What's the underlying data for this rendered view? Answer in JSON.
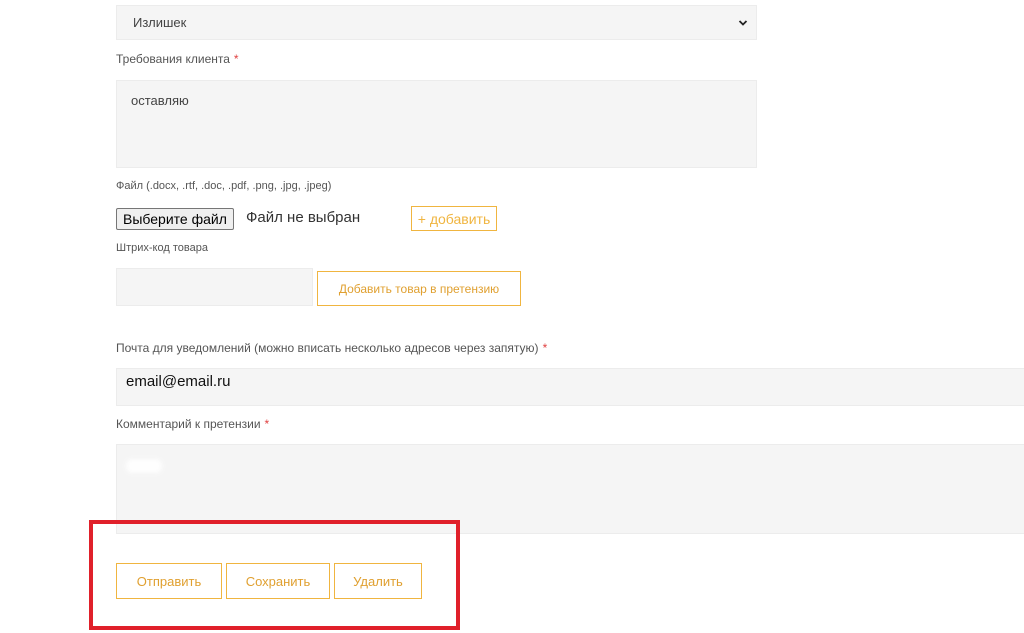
{
  "reason": {
    "value": "Излишек",
    "icon": "chevron-down-icon"
  },
  "client_requirements": {
    "label": "Требования клиента",
    "required_mark": "*",
    "value": "оставляю"
  },
  "file": {
    "label": "Файл (.docx, .rtf, .doc, .pdf, .png, .jpg, .jpeg)",
    "choose_label": "Выберите файл",
    "status": "Файл не выбран",
    "add_label": "+ добавить"
  },
  "barcode": {
    "label": "Штрих-код товара",
    "value": "",
    "add_label": "Добавить товар в претензию"
  },
  "email": {
    "label": "Почта для уведомлений (можно вписать несколько адресов через запятую)",
    "required_mark": "*",
    "value": "email@email.ru"
  },
  "comment": {
    "label": "Комментарий к претензии",
    "required_mark": "*",
    "value": ""
  },
  "actions": {
    "send": "Отправить",
    "save": "Сохранить",
    "delete": "Удалить"
  },
  "colors": {
    "accent": "#f0b540",
    "required": "#e04040",
    "highlight": "#e0202a",
    "field_bg": "#f5f5f5"
  }
}
